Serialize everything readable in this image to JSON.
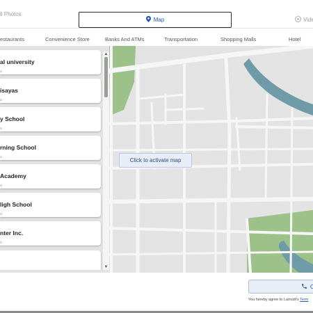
{
  "tabs": {
    "photos": "ll Photos",
    "map": "Map",
    "video": "Vide"
  },
  "categories": [
    "estaurants",
    "Convenience Store",
    "Banks And ATMs",
    "Transportation",
    "Shopping Malls",
    "Hotel"
  ],
  "places": [
    {
      "name": "al university",
      "sub": "u"
    },
    {
      "name": "isayas",
      "sub": "u"
    },
    {
      "name": "y School",
      "sub": "u"
    },
    {
      "name": "rning School",
      "sub": "u"
    },
    {
      "name": "Academy",
      "sub": "u"
    },
    {
      "name": "ligh School",
      "sub": "u"
    },
    {
      "name": "nter Inc.",
      "sub": "u"
    },
    {
      "name": "",
      "sub": ""
    }
  ],
  "map": {
    "activate_label": "Click to activate map"
  },
  "contact": {
    "call_label": "C",
    "agree_text": "You hereby agree to Lamudi's",
    "terms_link": "Term"
  },
  "colors": {
    "accent": "#2456a4",
    "water": "#6f9ba8",
    "park": "#9cc28a",
    "road": "#f4f4f4",
    "land": "#e3e3e3"
  }
}
